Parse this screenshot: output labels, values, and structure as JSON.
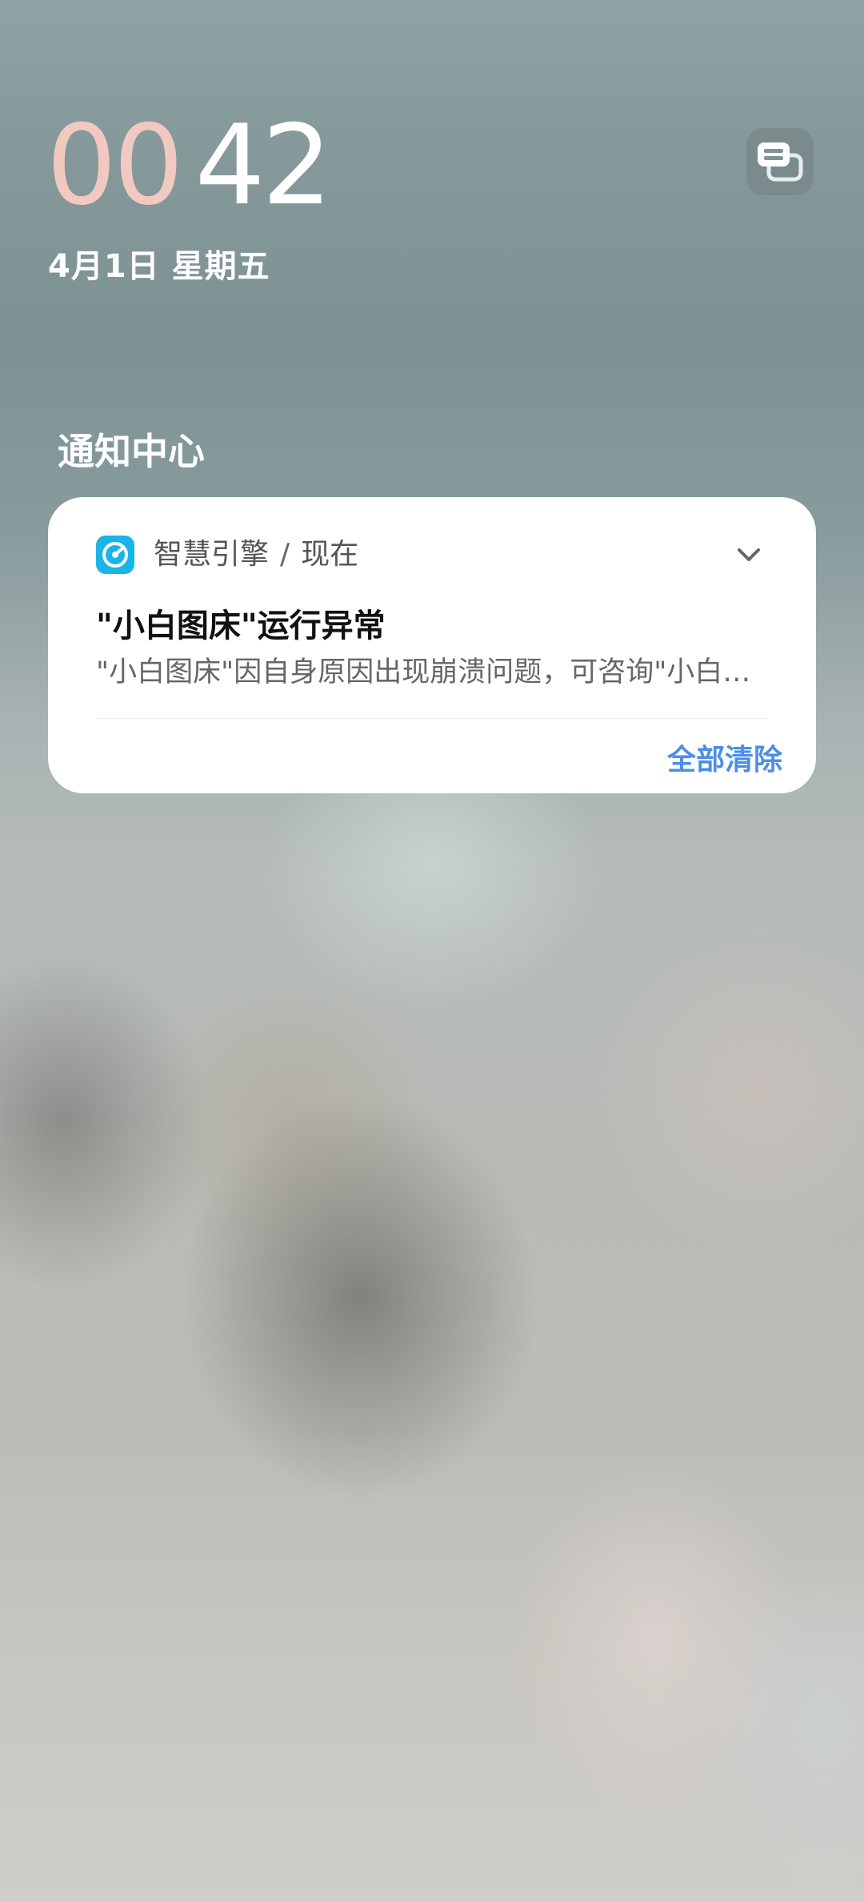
{
  "lockscreen": {
    "clock_hours": "00",
    "clock_minutes": "42",
    "date": "4月1日  星期五",
    "multi_notification_icon": "stacked-cards-icon",
    "clock_hours_color": "#f2c9c0"
  },
  "notification_center": {
    "title": "通知中心",
    "clear_all_label": "全部清除",
    "notifications": [
      {
        "app_icon": "gauge-icon",
        "app_icon_color": "#1ab4e8",
        "app_name": "智慧引擎",
        "separator": "/",
        "time": "现在",
        "title": "\"小白图床\"运行异常",
        "body": "\"小白图床\"因自身原因出现崩溃问题，可咨询\"小白…",
        "expand_icon": "chevron-down-icon"
      }
    ]
  },
  "colors": {
    "accent": "#4a8ee8",
    "card_background": "#ffffff"
  }
}
